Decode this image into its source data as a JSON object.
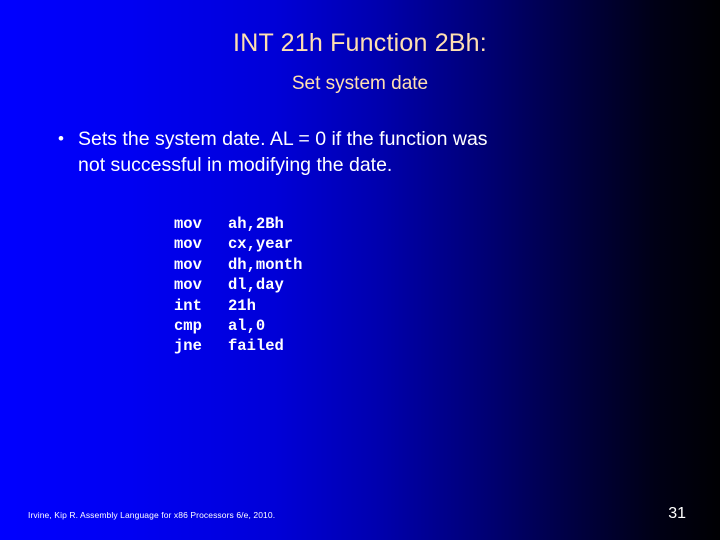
{
  "slide": {
    "title": "INT 21h Function 2Bh:",
    "subtitle": "Set system date",
    "bullet": {
      "marker": "•",
      "text": "Sets the system date. AL = 0 if the function was\nnot successful in modifying the date."
    },
    "code": {
      "lines": [
        {
          "op": "mov",
          "args": "ah,2Bh"
        },
        {
          "op": "mov",
          "args": "cx,year"
        },
        {
          "op": "mov",
          "args": "dh,month"
        },
        {
          "op": "mov",
          "args": "dl,day"
        },
        {
          "op": "int",
          "args": "21h"
        },
        {
          "op": "cmp",
          "args": "al,0"
        },
        {
          "op": "jne",
          "args": "failed"
        }
      ]
    },
    "footer": {
      "citation": "Irvine, Kip R. Assembly Language for x86 Processors 6/e, 2010.",
      "page_number": "31"
    },
    "colors": {
      "background_left": "#0000ff",
      "background_right": "#000003",
      "title": "#ffe0b0",
      "body_text": "#ffffff",
      "code_text": "#ffffff"
    }
  }
}
